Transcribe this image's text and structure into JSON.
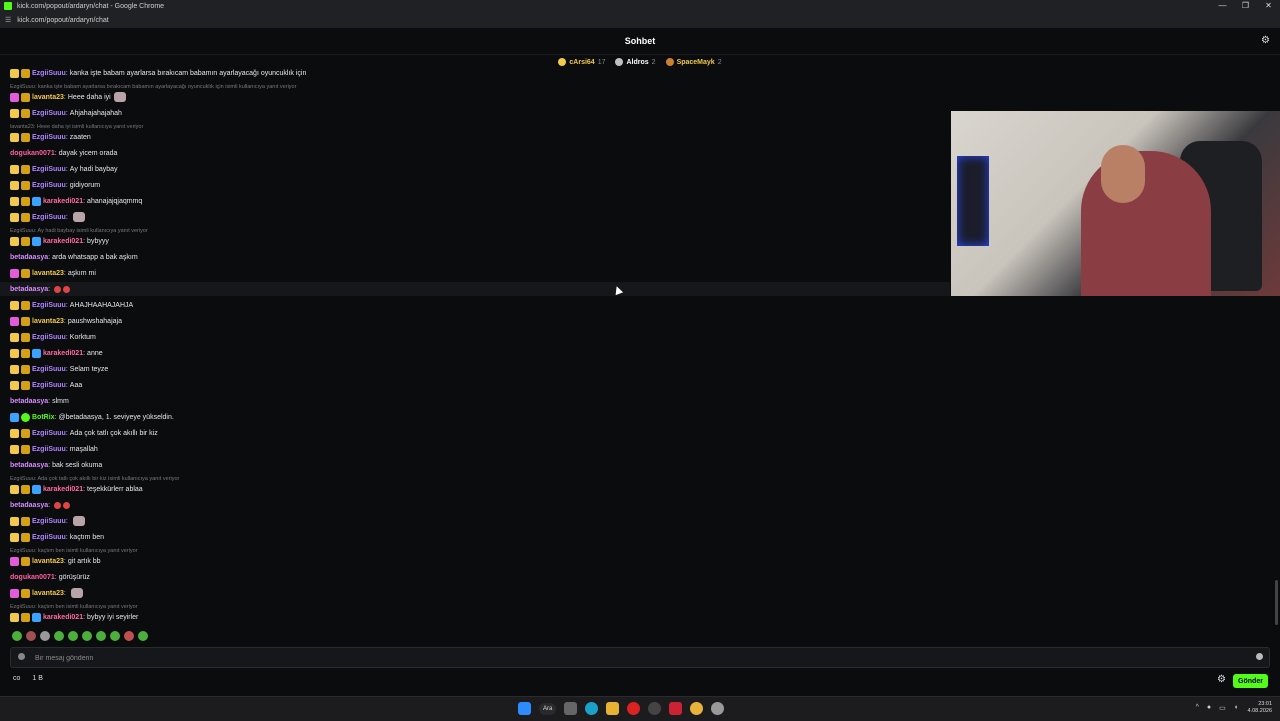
{
  "window": {
    "title": "kick.com/popout/ardaryn/chat - Google Chrome",
    "controls": [
      "—",
      "❐",
      "✕"
    ]
  },
  "address": {
    "url": "kick.com/popout/ardaryn/chat"
  },
  "header": {
    "title": "Sohbet"
  },
  "top_chatters": [
    {
      "name": "cArsi64",
      "count": "17",
      "color": "#f2c94c",
      "medal": "#f2c94c"
    },
    {
      "name": "Aldros",
      "count": "2",
      "color": "#ffffff",
      "medal": "#c0c0c0"
    },
    {
      "name": "SpaceMayk",
      "count": "2",
      "color": "#f2c94c",
      "medal": "#cd7f32"
    }
  ],
  "messages": [
    {
      "type": "msg",
      "badges": [
        "sub",
        "crown"
      ],
      "user": "EzgiiSuuu",
      "color": "#b084ff",
      "text": "kanka işte babam ayarlarsa bırakıcam babamın ayarlayacağı oyuncuklık için"
    },
    {
      "type": "reply",
      "text": "EzgiiSuuu: kanka işte babam ayarlarsa bırakıcam babamın ayarlayacağı oyuncuklık için isimli kullanıcıya yanıt veriyor"
    },
    {
      "type": "msg",
      "badges": [
        "vip",
        "crown"
      ],
      "user": "lavanta23",
      "color": "#f2c94c",
      "text": "Heee daha iyi",
      "emote": true
    },
    {
      "type": "msg",
      "badges": [
        "sub",
        "crown"
      ],
      "user": "EzgiiSuuu",
      "color": "#b084ff",
      "text": "Ahjahajahajahah"
    },
    {
      "type": "reply",
      "text": "lavanta23: Heee daha iyi isimli kullanıcıya yanıt veriyor"
    },
    {
      "type": "msg",
      "badges": [
        "sub",
        "crown"
      ],
      "user": "EzgiiSuuu",
      "color": "#b084ff",
      "text": "zaaten"
    },
    {
      "type": "msg",
      "badges": [],
      "user": "dogukan0071",
      "color": "#ff5fa2",
      "text": "dayak yicem orada"
    },
    {
      "type": "msg",
      "badges": [
        "sub",
        "crown"
      ],
      "user": "EzgiiSuuu",
      "color": "#b084ff",
      "text": "Ay hadi baybay"
    },
    {
      "type": "msg",
      "badges": [
        "sub",
        "crown"
      ],
      "user": "EzgiiSuuu",
      "color": "#b084ff",
      "text": "gidiyorum"
    },
    {
      "type": "msg",
      "badges": [
        "sub",
        "crown",
        "bot"
      ],
      "user": "karakedi021",
      "color": "#ff6b9e",
      "text": "ahanajajqjaqmmq"
    },
    {
      "type": "msg",
      "badges": [
        "sub",
        "crown"
      ],
      "user": "EzgiiSuuu",
      "color": "#b084ff",
      "text": "",
      "emote": true
    },
    {
      "type": "reply",
      "text": "EzgiiSuuu: Ay hadi baybay isimli kullanıcıya yanıt veriyor"
    },
    {
      "type": "msg",
      "badges": [
        "sub",
        "crown",
        "bot"
      ],
      "user": "karakedi021",
      "color": "#ff6b9e",
      "text": "bybyyy"
    },
    {
      "type": "msg",
      "badges": [],
      "user": "betadaasya",
      "color": "#d58cff",
      "text": "arda whatsapp a bak aşkım"
    },
    {
      "type": "msg",
      "badges": [
        "vip",
        "crown"
      ],
      "user": "lavanta23",
      "color": "#f2c94c",
      "text": "aşkım mi"
    },
    {
      "type": "msg",
      "badges": [],
      "user": "betadaasya",
      "color": "#d58cff",
      "text": "",
      "reds": 2,
      "highlight": true
    },
    {
      "type": "msg",
      "badges": [
        "sub",
        "crown"
      ],
      "user": "EzgiiSuuu",
      "color": "#b084ff",
      "text": "AHAJHAAHAJAHJA"
    },
    {
      "type": "msg",
      "badges": [
        "vip",
        "crown"
      ],
      "user": "lavanta23",
      "color": "#f2c94c",
      "text": "paushwshahajaja"
    },
    {
      "type": "msg",
      "badges": [
        "sub",
        "crown"
      ],
      "user": "EzgiiSuuu",
      "color": "#b084ff",
      "text": "Korktum"
    },
    {
      "type": "msg",
      "badges": [
        "sub",
        "crown",
        "bot"
      ],
      "user": "karakedi021",
      "color": "#ff6b9e",
      "text": "anne"
    },
    {
      "type": "msg",
      "badges": [
        "sub",
        "crown"
      ],
      "user": "EzgiiSuuu",
      "color": "#b084ff",
      "text": "Selam teyze"
    },
    {
      "type": "msg",
      "badges": [
        "sub",
        "crown"
      ],
      "user": "EzgiiSuuu",
      "color": "#b084ff",
      "text": "Aaa"
    },
    {
      "type": "msg",
      "badges": [],
      "user": "betadaasya",
      "color": "#d58cff",
      "text": "slmm"
    },
    {
      "type": "msg",
      "badges": [
        "bot",
        "og"
      ],
      "user": "BotRix",
      "color": "#53fc18",
      "text": "@betadaasya, 1. seviyeye yükseldin."
    },
    {
      "type": "msg",
      "badges": [
        "sub",
        "crown"
      ],
      "user": "EzgiiSuuu",
      "color": "#b084ff",
      "text": "Ada çok tatlı çok akıllı bir kiz"
    },
    {
      "type": "msg",
      "badges": [
        "sub",
        "crown"
      ],
      "user": "EzgiiSuuu",
      "color": "#b084ff",
      "text": "maşallah"
    },
    {
      "type": "msg",
      "badges": [],
      "user": "betadaasya",
      "color": "#d58cff",
      "text": "bak sesli okuma"
    },
    {
      "type": "reply",
      "text": "EzgiiSuuu: Ada çok tatlı çok akıllı bir kiz isimli kullanıcıya yanıt veriyor"
    },
    {
      "type": "msg",
      "badges": [
        "sub",
        "crown",
        "bot"
      ],
      "user": "karakedi021",
      "color": "#ff6b9e",
      "text": "teşekkürlerr ablaa"
    },
    {
      "type": "msg",
      "badges": [],
      "user": "betadaasya",
      "color": "#d58cff",
      "text": "",
      "reds": 2
    },
    {
      "type": "msg",
      "badges": [
        "sub",
        "crown"
      ],
      "user": "EzgiiSuuu",
      "color": "#b084ff",
      "text": "",
      "emote": true
    },
    {
      "type": "msg",
      "badges": [
        "sub",
        "crown"
      ],
      "user": "EzgiiSuuu",
      "color": "#b084ff",
      "text": "kaçtım ben"
    },
    {
      "type": "reply",
      "text": "EzgiiSuuu: kaçtım ben isimli kullanıcıya yanıt veriyor"
    },
    {
      "type": "msg",
      "badges": [
        "vip",
        "crown"
      ],
      "user": "lavanta23",
      "color": "#f2c94c",
      "text": "git artık bb"
    },
    {
      "type": "msg",
      "badges": [],
      "user": "dogukan0071",
      "color": "#ff5fa2",
      "text": "görüşürüz"
    },
    {
      "type": "msg",
      "badges": [
        "vip",
        "crown"
      ],
      "user": "lavanta23",
      "color": "#f2c94c",
      "text": "",
      "emote": true
    },
    {
      "type": "reply",
      "text": "EzgiiSuuu: kaçtım ben isimli kullanıcıya yanıt veriyor"
    },
    {
      "type": "msg",
      "badges": [
        "sub",
        "crown",
        "bot"
      ],
      "user": "karakedi021",
      "color": "#ff6b9e",
      "text": "bybyy iyi seyirler"
    }
  ],
  "input": {
    "placeholder": "Bir mesaj gönderin"
  },
  "footer": {
    "points_label": "co",
    "count": "1 B",
    "send_label": "Gönder"
  },
  "taskbar": {
    "search_label": "Ara",
    "time": "23:01",
    "date": "4.08.2026"
  }
}
